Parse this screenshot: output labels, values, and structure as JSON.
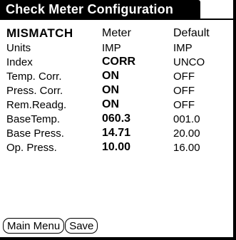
{
  "window": {
    "title": "Check Meter Configuration"
  },
  "table": {
    "header": {
      "label": "MISMATCH",
      "meter": "Meter",
      "default": "Default"
    },
    "rows": [
      {
        "label": "Units",
        "meter": "IMP",
        "default": "IMP",
        "meter_bold": false
      },
      {
        "label": "Index",
        "meter": "CORR",
        "default": "UNCO",
        "meter_bold": true
      },
      {
        "label": "Temp. Corr.",
        "meter": "ON",
        "default": "OFF",
        "meter_bold": true
      },
      {
        "label": "Press. Corr.",
        "meter": "ON",
        "default": "OFF",
        "meter_bold": true
      },
      {
        "label": "Rem.Readg.",
        "meter": "ON",
        "default": "OFF",
        "meter_bold": true
      },
      {
        "label": "BaseTemp.",
        "meter": "060.3",
        "default": "001.0",
        "meter_bold": true
      },
      {
        "label": "Base Press.",
        "meter": "14.71",
        "default": "20.00",
        "meter_bold": true
      },
      {
        "label": "Op. Press.",
        "meter": "10.00",
        "default": "16.00",
        "meter_bold": true
      }
    ]
  },
  "buttons": {
    "main_menu": "Main Menu",
    "save": "Save"
  }
}
